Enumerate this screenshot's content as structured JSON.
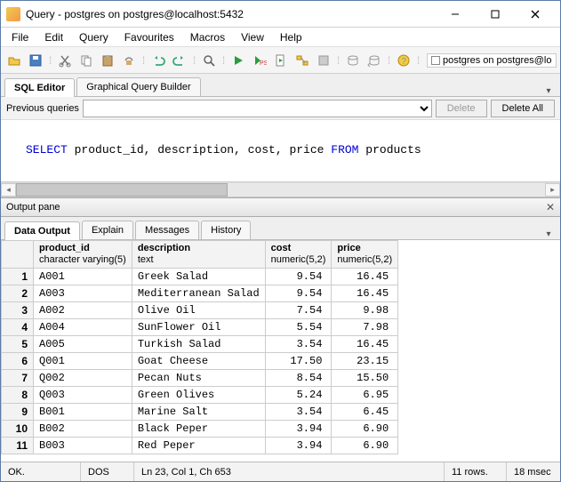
{
  "window": {
    "title": "Query - postgres on postgres@localhost:5432"
  },
  "menu": [
    "File",
    "Edit",
    "Query",
    "Favourites",
    "Macros",
    "View",
    "Help"
  ],
  "toolbar_db": "postgres on postgres@lo",
  "editor_tabs": {
    "sql": "SQL Editor",
    "gqb": "Graphical Query Builder"
  },
  "prev": {
    "label": "Previous queries",
    "delete": "Delete",
    "delete_all": "Delete All"
  },
  "sql": {
    "kw1": "SELECT",
    "body": " product_id, description, cost, price ",
    "kw2": "FROM",
    "tail": " products"
  },
  "output_pane": {
    "title": "Output pane"
  },
  "out_tabs": {
    "data": "Data Output",
    "explain": "Explain",
    "messages": "Messages",
    "history": "History"
  },
  "columns": [
    {
      "name": "product_id",
      "type": "character varying(5)",
      "numeric": false
    },
    {
      "name": "description",
      "type": "text",
      "numeric": false
    },
    {
      "name": "cost",
      "type": "numeric(5,2)",
      "numeric": true
    },
    {
      "name": "price",
      "type": "numeric(5,2)",
      "numeric": true
    }
  ],
  "rows": [
    [
      "A001",
      "Greek Salad",
      "9.54",
      "16.45"
    ],
    [
      "A003",
      "Mediterranean Salad",
      "9.54",
      "16.45"
    ],
    [
      "A002",
      "Olive Oil",
      "7.54",
      "9.98"
    ],
    [
      "A004",
      "SunFlower Oil",
      "5.54",
      "7.98"
    ],
    [
      "A005",
      "Turkish Salad",
      "3.54",
      "16.45"
    ],
    [
      "Q001",
      "Goat Cheese",
      "17.50",
      "23.15"
    ],
    [
      "Q002",
      "Pecan Nuts",
      "8.54",
      "15.50"
    ],
    [
      "Q003",
      "Green Olives",
      "5.24",
      "6.95"
    ],
    [
      "B001",
      "Marine Salt",
      "3.54",
      "6.45"
    ],
    [
      "B002",
      "Black Peper",
      "3.94",
      "6.90"
    ],
    [
      "B003",
      "Red Peper",
      "3.94",
      "6.90"
    ]
  ],
  "status": {
    "ok": "OK.",
    "enc": "DOS",
    "pos": "Ln 23, Col 1, Ch 653",
    "rows": "11 rows.",
    "time": "18 msec"
  }
}
